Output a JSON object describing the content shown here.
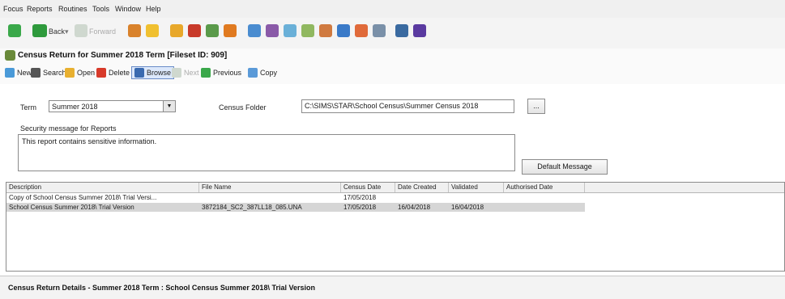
{
  "menu": [
    "Focus",
    "Reports",
    "Routines",
    "Tools",
    "Window",
    "Help"
  ],
  "toolbar": {
    "back_label": "Back",
    "forward_label": "Forward"
  },
  "window": {
    "title": "Census Return for Summer 2018 Term [Fileset ID: 909]"
  },
  "actions": {
    "new": "New",
    "search": "Search",
    "open": "Open",
    "delete": "Delete",
    "browse": "Browse",
    "next": "Next",
    "previous": "Previous",
    "copy": "Copy"
  },
  "form": {
    "term_label": "Term",
    "term_value": "Summer 2018",
    "folder_label": "Census Folder",
    "folder_value": "C:\\SIMS\\STAR\\School Census\\Summer Census 2018",
    "folder_button": "...",
    "security_label": "Security message for Reports",
    "security_value": "This report contains sensitive information.",
    "default_message_button": "Default Message"
  },
  "grid": {
    "columns": [
      "Description",
      "File Name",
      "Census Date",
      "Date Created",
      "Validated",
      "Authorised Date"
    ],
    "rows": [
      [
        "Copy of School Census Summer 2018\\ Trial Versi...",
        "",
        "17/05/2018",
        "",
        "",
        ""
      ],
      [
        "School Census Summer 2018\\ Trial Version",
        "3872184_SC2_387LL18_085.UNA",
        "17/05/2018",
        "16/04/2018",
        "16/04/2018",
        ""
      ]
    ]
  },
  "footer": {
    "title": "Census Return Details - Summer 2018 Term : School Census Summer 2018\\ Trial Version"
  }
}
